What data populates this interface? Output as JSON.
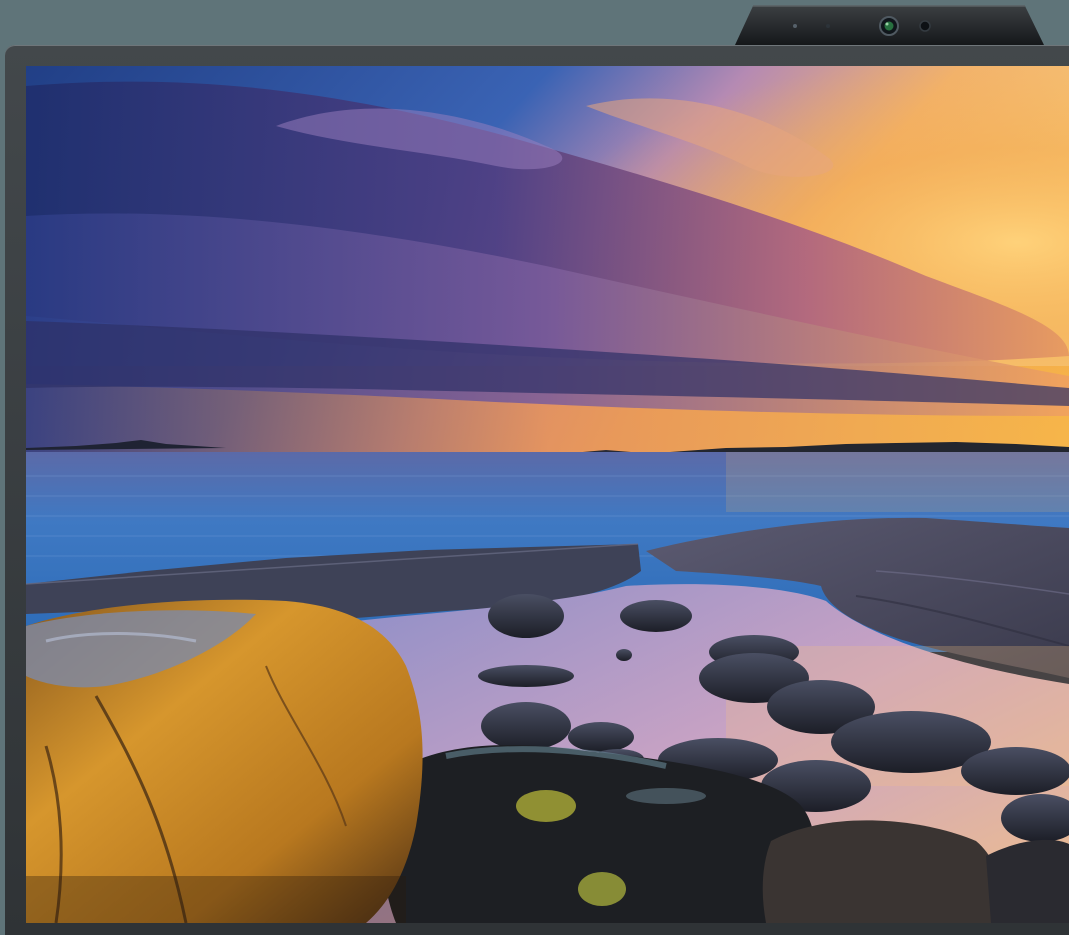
{
  "scene": {
    "subject": "monitor",
    "wallpaper": "coastal-sunset",
    "colors": {
      "wall": "#5f7479",
      "bezel": "#3b4043",
      "sky_top": "#2a4f9a",
      "sunset_glow": "#f3a63d",
      "sea": "#3f7bc4",
      "rock_lit": "#c98b2a"
    }
  }
}
